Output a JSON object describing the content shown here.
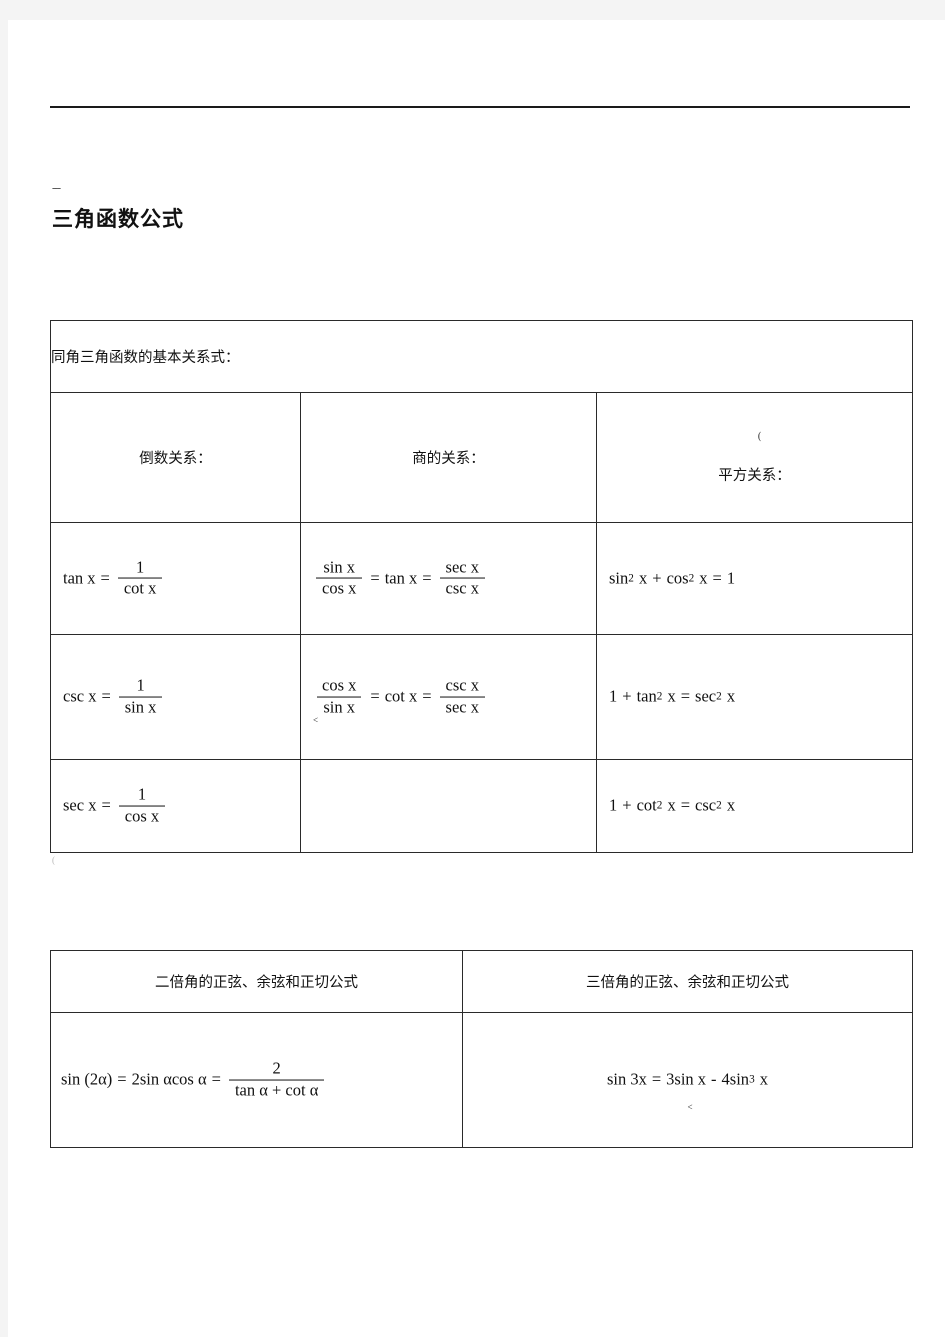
{
  "document": {
    "title": "三角函数公式",
    "title_mark": "---",
    "left_margin_mark": "("
  },
  "table_basic_relations": {
    "banner": "同角三角函数的基本关系式：",
    "headers": [
      {
        "label": "倒数关系：",
        "mark": ""
      },
      {
        "label": "商的关系：",
        "mark": ""
      },
      {
        "label": "平方关系：",
        "mark": "("
      }
    ],
    "rows": [
      {
        "reciprocal": {
          "lhs": "tan x",
          "eq": "=",
          "num": "1",
          "den": "cot x"
        },
        "quotient": {
          "num1": "sin x",
          "den1": "cos x",
          "eq1": "=",
          "mid": "tan x",
          "eq2": "=",
          "num2": "sec x",
          "den2": "csc x",
          "mark": ""
        },
        "pythagorean": {
          "a": "sin",
          "a_exp": "2",
          "a_var": "x",
          "plus": "+",
          "b": "cos",
          "b_exp": "2",
          "b_var": "x",
          "eq": "=",
          "rhs": "1"
        }
      },
      {
        "reciprocal": {
          "lhs": "csc x",
          "eq": "=",
          "num": "1",
          "den": "sin x"
        },
        "quotient": {
          "num1": "cos x",
          "den1": "sin x",
          "eq1": "=",
          "mid": "cot x",
          "eq2": "=",
          "num2": "csc x",
          "den2": "sec x",
          "mark": "<"
        },
        "pythagorean": {
          "a": "1",
          "plus": "+",
          "b": "tan",
          "b_exp": "2",
          "b_var": "x",
          "eq": "=",
          "c": "sec",
          "c_exp": "2",
          "c_var": "x"
        }
      },
      {
        "reciprocal": {
          "lhs": "sec x",
          "eq": "=",
          "num": "1",
          "den": "cos x"
        },
        "quotient": {
          "empty": ""
        },
        "pythagorean": {
          "a": "1",
          "plus": "+",
          "b": "cot",
          "b_exp": "2",
          "b_var": "x",
          "eq": "=",
          "c": "csc",
          "c_exp": "2",
          "c_var": "x"
        }
      }
    ]
  },
  "table_multiple_angle": {
    "headers": [
      "二倍角的正弦、余弦和正切公式",
      "三倍角的正弦、余弦和正切公式"
    ],
    "double_angle": {
      "lhs": "sin (2α)",
      "eq1": "=",
      "mid": "2sin αcos α",
      "eq2": "=",
      "num": "2",
      "den": "tan α + cot α"
    },
    "triple_angle": {
      "mark": "<",
      "lhs": "sin 3x",
      "eq": "=",
      "term1": "3sin x",
      "minus": "-",
      "term2_coef": "4sin",
      "term2_exp": "3",
      "term2_var": "x"
    }
  }
}
